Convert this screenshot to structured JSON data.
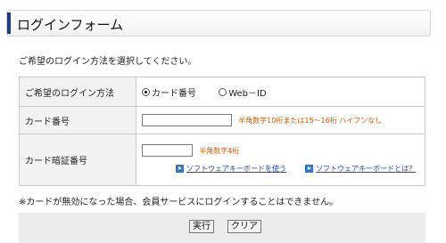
{
  "header": {
    "title": "ログインフォーム"
  },
  "intro": "ご希望のログイン方法を選択してください。",
  "form": {
    "method_label": "ご希望のログイン方法",
    "methods": [
      {
        "label": "カード番号",
        "selected": true
      },
      {
        "label": "Web－ID",
        "selected": false
      }
    ],
    "card_number_label": "カード番号",
    "card_number_value": "",
    "card_number_hint": "半角数字10桁または15～16桁 ハイフンなし",
    "pin_label": "カード暗証番号",
    "pin_value": "",
    "pin_hint": "半角数字4桁",
    "links": [
      {
        "label": "ソフトウェアキーボードを使う",
        "icon": "arrow-right-icon"
      },
      {
        "label": "ソフトウェアキーボードとは？",
        "icon": "arrow-right-icon"
      }
    ]
  },
  "note": "※カードが無効になった場合、会員サービスにログインすることはできません。",
  "buttons": {
    "submit": "実行",
    "clear": "クリア"
  },
  "colors": {
    "accent": "#1f3d7a",
    "hint": "#d05a0a",
    "link": "#1a4ea8"
  }
}
